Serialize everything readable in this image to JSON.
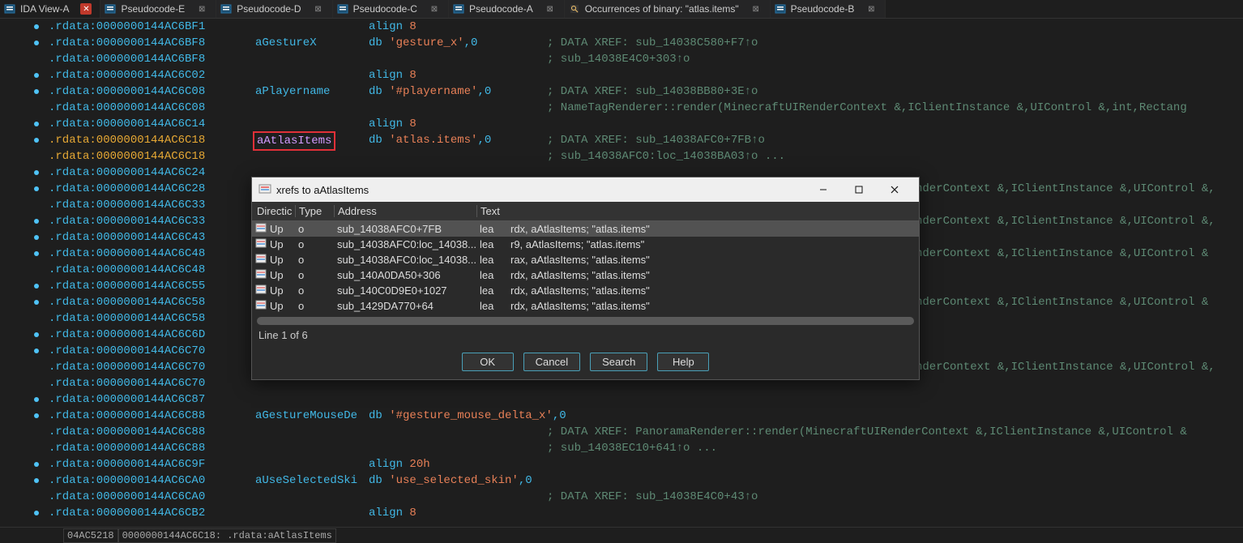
{
  "tabs": [
    {
      "label": "IDA View-A",
      "active": true,
      "closeRed": true
    },
    {
      "label": "Pseudocode-E"
    },
    {
      "label": "Pseudocode-D"
    },
    {
      "label": "Pseudocode-C"
    },
    {
      "label": "Pseudocode-A"
    },
    {
      "label": "Occurrences of binary: \"atlas.items\"",
      "iconVariant": "search"
    },
    {
      "label": "Pseudocode-B"
    }
  ],
  "disasm": {
    "lines": [
      {
        "bullet": true,
        "seg": ".rdata:0000000144AC6BF1",
        "align": "align",
        "alignVal": "8"
      },
      {
        "bullet": true,
        "seg": ".rdata:0000000144AC6BF8",
        "label": "aGestureX",
        "db": "db",
        "str": "'gesture_x'",
        "zero": ",0",
        "cmt": "; DATA XREF: sub_14038C580+F7↑o"
      },
      {
        "seg": ".rdata:0000000144AC6BF8",
        "cmt": "; sub_14038E4C0+303↑o"
      },
      {
        "bullet": true,
        "seg": ".rdata:0000000144AC6C02",
        "align": "align",
        "alignVal": "8"
      },
      {
        "bullet": true,
        "seg": ".rdata:0000000144AC6C08",
        "label": "aPlayername",
        "db": "db",
        "str": "'#playername'",
        "zero": ",0",
        "cmt": "; DATA XREF: sub_14038BB80+3E↑o"
      },
      {
        "seg": ".rdata:0000000144AC6C08",
        "cmt": "; NameTagRenderer::render(MinecraftUIRenderContext &,IClientInstance &,UIControl &,int,Rectang"
      },
      {
        "bullet": true,
        "seg": ".rdata:0000000144AC6C14",
        "align": "align",
        "alignVal": "8"
      },
      {
        "bullet": true,
        "hi": true,
        "seg": ".rdata:0000000144AC6C18",
        "box": true,
        "boxLabel": "aAtlasItems",
        "db": "db",
        "str": "'atlas.items'",
        "zero": ",0",
        "cmt": "; DATA XREF: sub_14038AFC0+7FB↑o"
      },
      {
        "hi": true,
        "seg": ".rdata:0000000144AC6C18",
        "cmt": "; sub_14038AFC0:loc_14038BA03↑o ..."
      },
      {
        "bullet": true,
        "seg": ".rdata:0000000144AC6C24"
      },
      {
        "bullet": true,
        "seg": ".rdata:0000000144AC6C28",
        "cmt": "nderContext &,IClientInstance &,UIControl &,"
      },
      {
        "seg": ".rdata:0000000144AC6C33"
      },
      {
        "bullet": true,
        "seg": ".rdata:0000000144AC6C33",
        "cmt": "nderContext &,IClientInstance &,UIControl &,"
      },
      {
        "bullet": true,
        "seg": ".rdata:0000000144AC6C43"
      },
      {
        "bullet": true,
        "seg": ".rdata:0000000144AC6C48",
        "cmt": "nderContext &,IClientInstance &,UIControl &"
      },
      {
        "seg": ".rdata:0000000144AC6C48"
      },
      {
        "bullet": true,
        "seg": ".rdata:0000000144AC6C55"
      },
      {
        "bullet": true,
        "seg": ".rdata:0000000144AC6C58",
        "cmt": "nderContext &,IClientInstance &,UIControl &"
      },
      {
        "seg": ".rdata:0000000144AC6C58"
      },
      {
        "bullet": true,
        "seg": ".rdata:0000000144AC6C6D"
      },
      {
        "bullet": true,
        "seg": ".rdata:0000000144AC6C70"
      },
      {
        "seg": ".rdata:0000000144AC6C70",
        "cmt": "nderContext &,IClientInstance &,UIControl &,"
      },
      {
        "seg": ".rdata:0000000144AC6C70"
      },
      {
        "bullet": true,
        "seg": ".rdata:0000000144AC6C87"
      },
      {
        "bullet": true,
        "seg": ".rdata:0000000144AC6C88",
        "label": "aGestureMouseDe",
        "db": "db",
        "str": "'#gesture_mouse_delta_x'",
        "zero": ",0"
      },
      {
        "seg": ".rdata:0000000144AC6C88",
        "cmt": "; DATA XREF: PanoramaRenderer::render(MinecraftUIRenderContext &,IClientInstance &,UIControl &"
      },
      {
        "seg": ".rdata:0000000144AC6C88",
        "cmt": "; sub_14038EC10+641↑o ..."
      },
      {
        "bullet": true,
        "seg": ".rdata:0000000144AC6C9F",
        "align": "align",
        "alignVal": "20h"
      },
      {
        "bullet": true,
        "seg": ".rdata:0000000144AC6CA0",
        "label": "aUseSelectedSki",
        "db": "db",
        "str": "'use_selected_skin'",
        "zero": ",0"
      },
      {
        "seg": ".rdata:0000000144AC6CA0",
        "cmt": "; DATA XREF: sub_14038E4C0+43↑o"
      },
      {
        "bullet": true,
        "seg": ".rdata:0000000144AC6CB2",
        "align": "align",
        "alignVal": "8"
      }
    ]
  },
  "dialog": {
    "title": "xrefs to aAtlasItems",
    "headers": {
      "dir": "Directic",
      "type": "Type",
      "addr": "Address",
      "text": "Text"
    },
    "rows": [
      {
        "dir": "Up",
        "type": "o",
        "addr": "sub_14038AFC0+7FB",
        "inst": "lea",
        "text": "rdx, aAtlasItems; \"atlas.items\"",
        "sel": true
      },
      {
        "dir": "Up",
        "type": "o",
        "addr": "sub_14038AFC0:loc_14038...",
        "inst": "lea",
        "text": "r9, aAtlasItems; \"atlas.items\""
      },
      {
        "dir": "Up",
        "type": "o",
        "addr": "sub_14038AFC0:loc_14038...",
        "inst": "lea",
        "text": "rax, aAtlasItems; \"atlas.items\""
      },
      {
        "dir": "Up",
        "type": "o",
        "addr": "sub_140A0DA50+306",
        "inst": "lea",
        "text": "rdx, aAtlasItems; \"atlas.items\""
      },
      {
        "dir": "Up",
        "type": "o",
        "addr": "sub_140C0D9E0+1027",
        "inst": "lea",
        "text": "rdx, aAtlasItems; \"atlas.items\""
      },
      {
        "dir": "Up",
        "type": "o",
        "addr": "sub_1429DA770+64",
        "inst": "lea",
        "text": "rdx, aAtlasItems; \"atlas.items\""
      }
    ],
    "status": "Line 1 of 6",
    "buttons": {
      "ok": "OK",
      "cancel": "Cancel",
      "search": "Search",
      "help": "Help"
    }
  },
  "statusbar": {
    "cell1": "04AC5218",
    "cell2": "0000000144AC6C18: .rdata:aAtlasItems"
  }
}
